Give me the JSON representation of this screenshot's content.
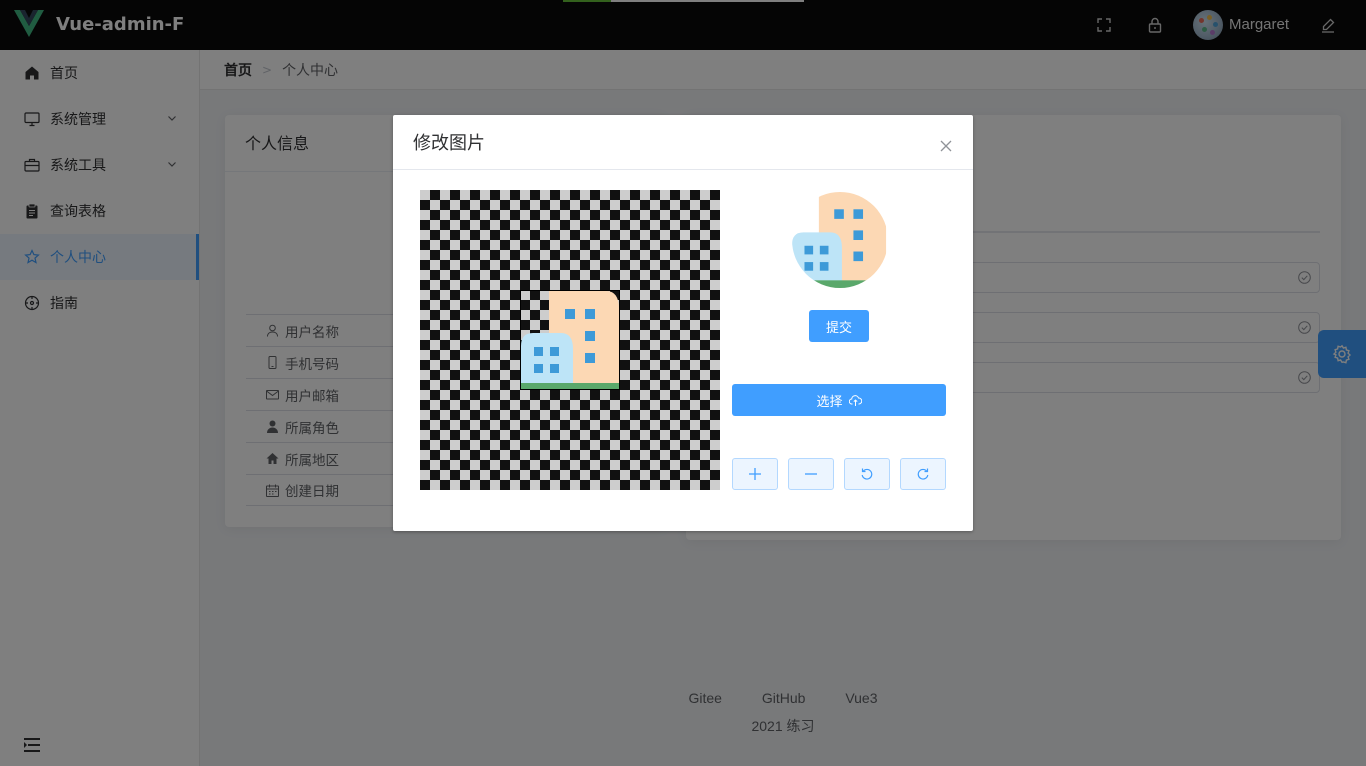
{
  "header": {
    "app_title": "Vue-admin-F",
    "username": "Margaret",
    "icons": [
      "fullscreen-icon",
      "lock-icon",
      "edit-icon"
    ]
  },
  "sidebar": {
    "items": [
      {
        "label": "首页",
        "icon": "home-icon"
      },
      {
        "label": "系统管理",
        "icon": "monitor-icon",
        "expandable": true
      },
      {
        "label": "系统工具",
        "icon": "briefcase-icon",
        "expandable": true
      },
      {
        "label": "查询表格",
        "icon": "clipboard-icon"
      },
      {
        "label": "个人中心",
        "icon": "star-icon",
        "active": true
      },
      {
        "label": "指南",
        "icon": "compass-icon"
      }
    ]
  },
  "breadcrumb": {
    "home": "首页",
    "separator": ">",
    "current": "个人中心"
  },
  "profile_card": {
    "title": "个人信息",
    "rows": [
      {
        "label": "用户名称",
        "icon": "user-icon"
      },
      {
        "label": "手机号码",
        "icon": "phone-icon"
      },
      {
        "label": "用户邮箱",
        "icon": "mail-icon"
      },
      {
        "label": "所属角色",
        "icon": "person-icon"
      },
      {
        "label": "所属地区",
        "icon": "house-icon"
      },
      {
        "label": "创建日期",
        "icon": "calendar-icon"
      }
    ]
  },
  "dialog": {
    "title": "修改图片",
    "submit_label": "提交",
    "choose_label": "选择",
    "tools": [
      "plus-icon",
      "minus-icon",
      "rotate-left-icon",
      "rotate-right-icon"
    ]
  },
  "footer": {
    "links": [
      "Gitee",
      "GitHub",
      "Vue3"
    ],
    "copyright": "2021 练习"
  },
  "colors": {
    "primary": "#409eff",
    "header_bg": "#0b0b0b",
    "mask": "rgba(0,0,0,0.5)"
  },
  "progress": 0.2
}
